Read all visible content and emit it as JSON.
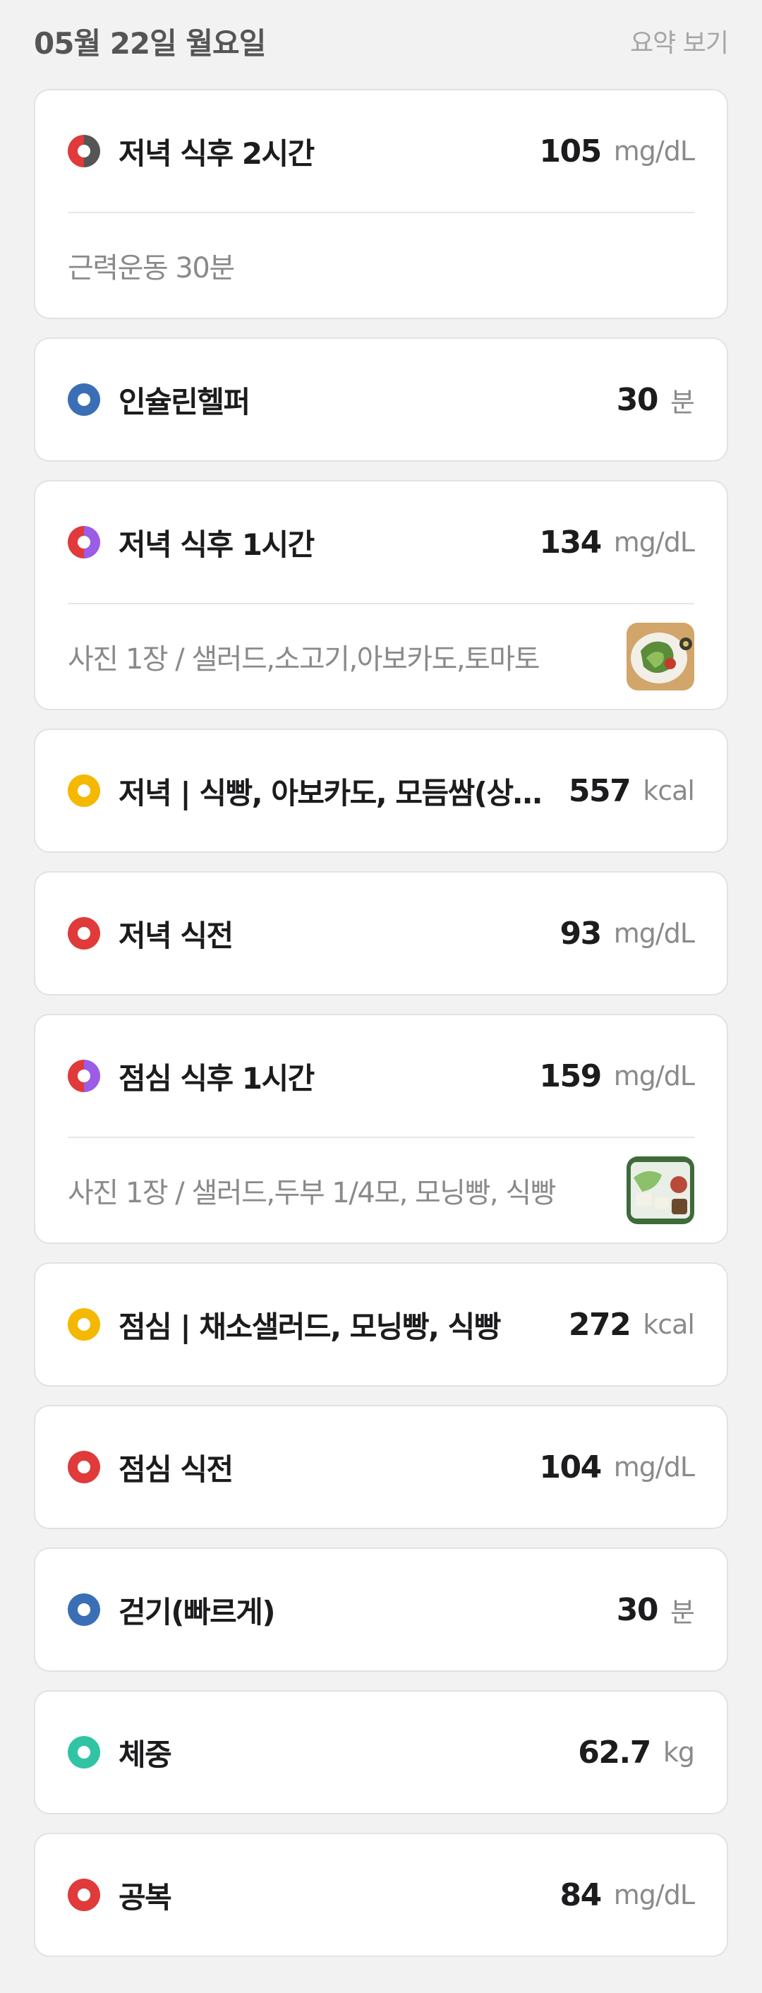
{
  "header": {
    "date": "05월 22일 월요일",
    "summary_link": "요약 보기"
  },
  "colors": {
    "glucose_after": [
      "#e03a3a",
      "#555555"
    ],
    "glucose_after_1h": [
      "#e03a3a",
      "#9b5de5"
    ],
    "glucose_before": "#e03a3a",
    "exercise": "#3a6fb5",
    "meal": "#f5b800",
    "weight": "#30c4a4"
  },
  "entries": [
    {
      "label": "저녁 식후 2시간",
      "value": "105",
      "unit": "mg/dL",
      "icon": "glucose-after-meal-icon",
      "sub": "근력운동 30분"
    },
    {
      "label": "인슐린헬퍼",
      "value": "30",
      "unit": "분",
      "icon": "exercise-icon"
    },
    {
      "label": "저녁 식후 1시간",
      "value": "134",
      "unit": "mg/dL",
      "icon": "glucose-after-meal-icon",
      "sub": "사진 1장 / 샐러드,소고기,아보카도,토마토",
      "photo": "meal-photo-thumbnail"
    },
    {
      "label": "저녁 | 식빵, 아보카도, 모듬쌈(상추,깻잎)",
      "value": "557",
      "unit": "kcal",
      "icon": "meal-icon"
    },
    {
      "label": "저녁 식전",
      "value": "93",
      "unit": "mg/dL",
      "icon": "glucose-before-meal-icon"
    },
    {
      "label": "점심 식후 1시간",
      "value": "159",
      "unit": "mg/dL",
      "icon": "glucose-after-meal-icon",
      "sub": "사진 1장 / 샐러드,두부 1/4모, 모닝빵, 식빵",
      "photo": "meal-photo-thumbnail"
    },
    {
      "label": "점심 | 채소샐러드, 모닝빵, 식빵",
      "value": "272",
      "unit": "kcal",
      "icon": "meal-icon"
    },
    {
      "label": "점심 식전",
      "value": "104",
      "unit": "mg/dL",
      "icon": "glucose-before-meal-icon"
    },
    {
      "label": "걷기(빠르게)",
      "value": "30",
      "unit": "분",
      "icon": "exercise-icon"
    },
    {
      "label": "체중",
      "value": "62.7",
      "unit": "kg",
      "icon": "weight-icon"
    },
    {
      "label": "공복",
      "value": "84",
      "unit": "mg/dL",
      "icon": "glucose-fasting-icon"
    }
  ]
}
